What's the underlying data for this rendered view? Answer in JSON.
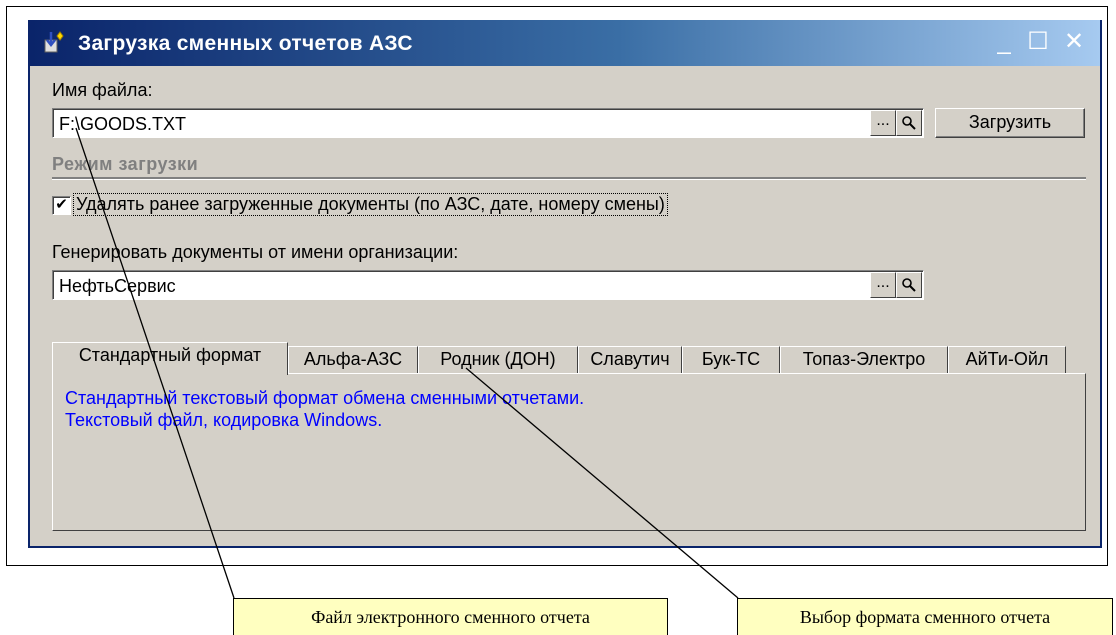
{
  "window": {
    "title": "Загрузка сменных отчетов АЗС",
    "minimize": "_",
    "maximize": "☐",
    "close": "✕"
  },
  "file": {
    "label": "Имя файла:",
    "value": "F:\\GOODS.TXT",
    "browse": "...",
    "open": "🔍",
    "load_button": "Загрузить"
  },
  "mode": {
    "section_title": "Режим загрузки",
    "delete_checkbox": {
      "checked": true,
      "mark": "✔",
      "label": "Удалять ранее загруженные документы (по АЗС, дате, номеру смены)"
    }
  },
  "org": {
    "label": "Генерировать документы от имени организации:",
    "value": "НефтьСервис",
    "browse": "...",
    "open": "🔍"
  },
  "tabs": [
    {
      "label": "Стандартный формат",
      "active": true
    },
    {
      "label": "Альфа-АЗС",
      "active": false
    },
    {
      "label": "Родник (ДОН)",
      "active": false
    },
    {
      "label": "Славутич",
      "active": false
    },
    {
      "label": "Бук-ТС",
      "active": false
    },
    {
      "label": "Топаз-Электро",
      "active": false
    },
    {
      "label": "АйТи-Ойл",
      "active": false
    }
  ],
  "tab_panel": {
    "line1": "Стандартный текстовый формат обмена сменными отчетами.",
    "line2": "Текстовый файл, кодировка Windows."
  },
  "callouts": {
    "file": "Файл электронного сменного отчета",
    "format": "Выбор формата сменного отчета"
  },
  "colors": {
    "title_bar": "#0a246a",
    "description_text": "#0000ff",
    "callout_bg": "#ffffc0"
  }
}
